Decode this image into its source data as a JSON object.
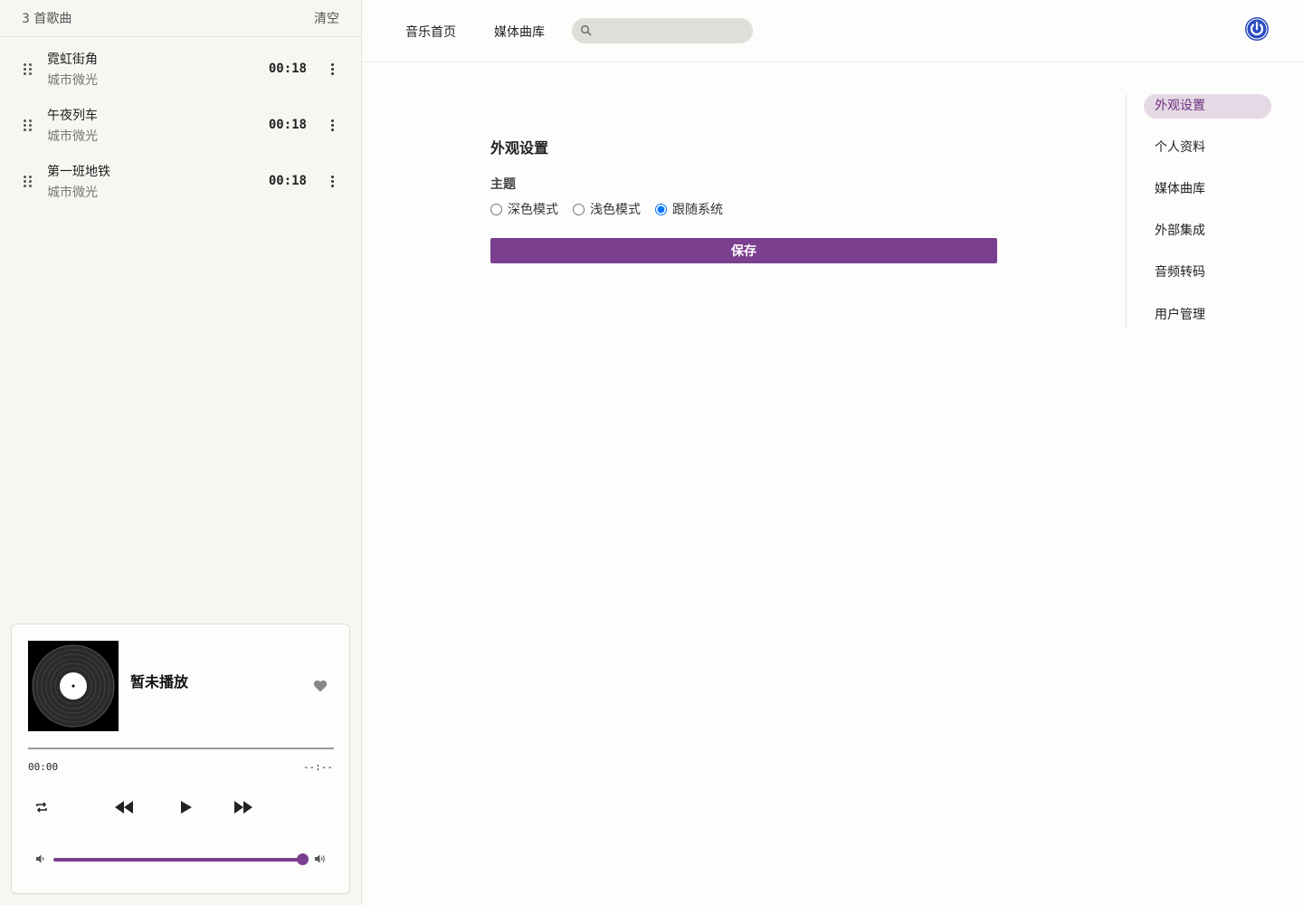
{
  "queue": {
    "count_label": "3 首歌曲",
    "clear_label": "清空",
    "items": [
      {
        "title": "霓虹街角",
        "artist": "城市微光",
        "duration": "00:18"
      },
      {
        "title": "午夜列车",
        "artist": "城市微光",
        "duration": "00:18"
      },
      {
        "title": "第一班地铁",
        "artist": "城市微光",
        "duration": "00:18"
      }
    ]
  },
  "player": {
    "now_playing": "暂未播放",
    "current_time": "00:00",
    "total_time": "--:--",
    "progress": 0,
    "volume": 1.0
  },
  "topnav": {
    "home": "音乐首页",
    "library": "媒体曲库",
    "search_placeholder": ""
  },
  "settings": {
    "title": "外观设置",
    "theme_label": "主题",
    "options": [
      "深色模式",
      "浅色模式",
      "跟随系统"
    ],
    "selected": "跟随系统",
    "save_label": "保存",
    "nav": [
      "外观设置",
      "个人资料",
      "媒体曲库",
      "外部集成",
      "音频转码",
      "用户管理"
    ],
    "active_nav": "外观设置"
  },
  "colors": {
    "accent": "#7b3f8f",
    "active_nav_bg": "#e6d9e6",
    "power": "#2c4dbf"
  }
}
